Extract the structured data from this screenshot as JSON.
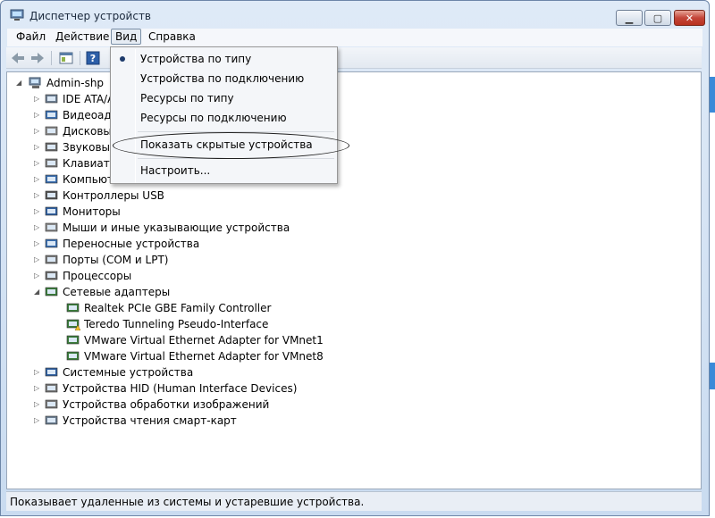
{
  "window": {
    "title": "Диспетчер устройств"
  },
  "menu": [
    "Файл",
    "Действие",
    "Вид",
    "Справка"
  ],
  "view_menu": {
    "items": [
      {
        "label": "Устройства по типу",
        "checked": true
      },
      {
        "label": "Устройства по подключению"
      },
      {
        "label": "Ресурсы по типу"
      },
      {
        "label": "Ресурсы по подключению"
      },
      {
        "label": "Показать скрытые устройства"
      },
      {
        "label": "Настроить..."
      }
    ]
  },
  "tree": {
    "root": "Admin-shp",
    "categories": [
      "IDE ATA/A",
      "Видеоада",
      "Дисковы",
      "Звуковые",
      "Клавиату",
      "Компьют",
      "Контроллеры USB",
      "Мониторы",
      "Мыши и иные указывающие устройства",
      "Переносные устройства",
      "Порты (COM и LPT)",
      "Процессоры",
      "Сетевые адаптеры"
    ],
    "network_children": [
      "Realtek PCIe GBE Family Controller",
      "Teredo Tunneling Pseudo-Interface",
      "VMware Virtual Ethernet Adapter for VMnet1",
      "VMware Virtual Ethernet Adapter for VMnet8"
    ],
    "categories_after": [
      "Системные устройства",
      "Устройства HID (Human Interface Devices)",
      "Устройства обработки изображений",
      "Устройства чтения смарт-карт"
    ]
  },
  "status": "Показывает удаленные из системы и устаревшие устройства.",
  "icons": {
    "back": "back-arrow-icon",
    "forward": "forward-arrow-icon",
    "properties": "properties-icon",
    "help": "help-icon"
  },
  "colors": {
    "accent": "#3a8ad8",
    "highlight_oval": "#222222"
  }
}
